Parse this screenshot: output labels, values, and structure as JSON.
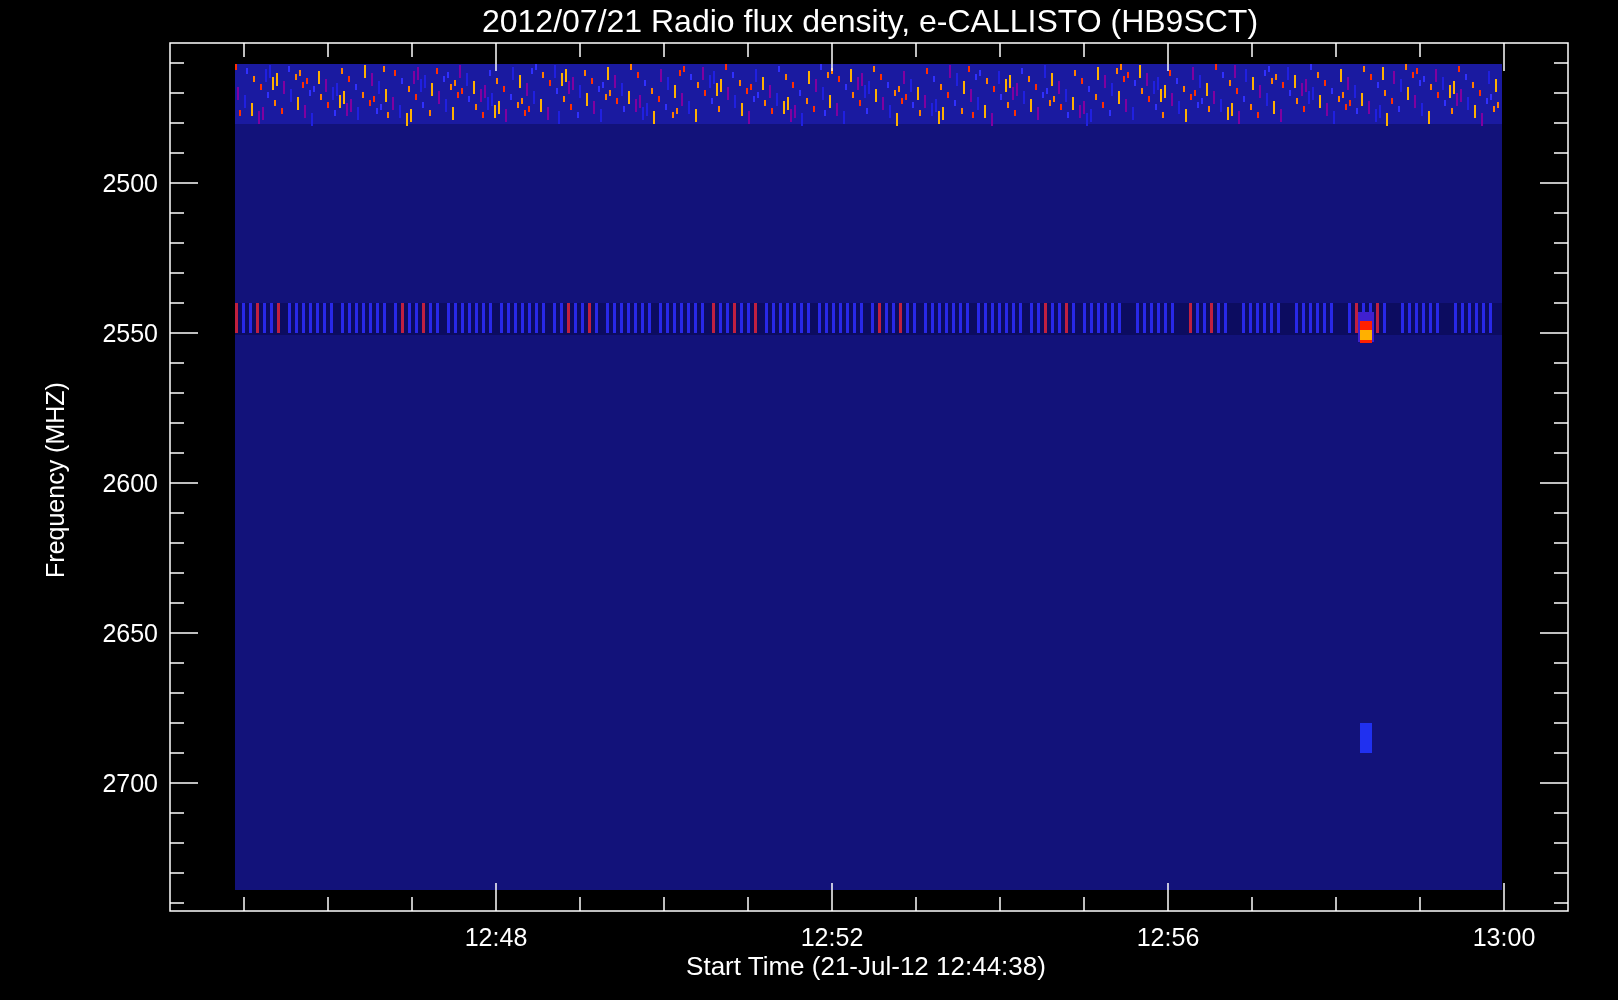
{
  "plot": {
    "title": "2012/07/21  Radio flux density, e-CALLISTO (HB9SCT)",
    "y_axis": {
      "label": "Frequency (MHZ)",
      "ticks": [
        "2500",
        "2550",
        "2600",
        "2650",
        "2700"
      ]
    },
    "x_axis": {
      "label": "Start Time (21-Jul-12 12:44:38)",
      "ticks": [
        "12:48",
        "12:52",
        "12:56",
        "13:00"
      ]
    }
  }
}
